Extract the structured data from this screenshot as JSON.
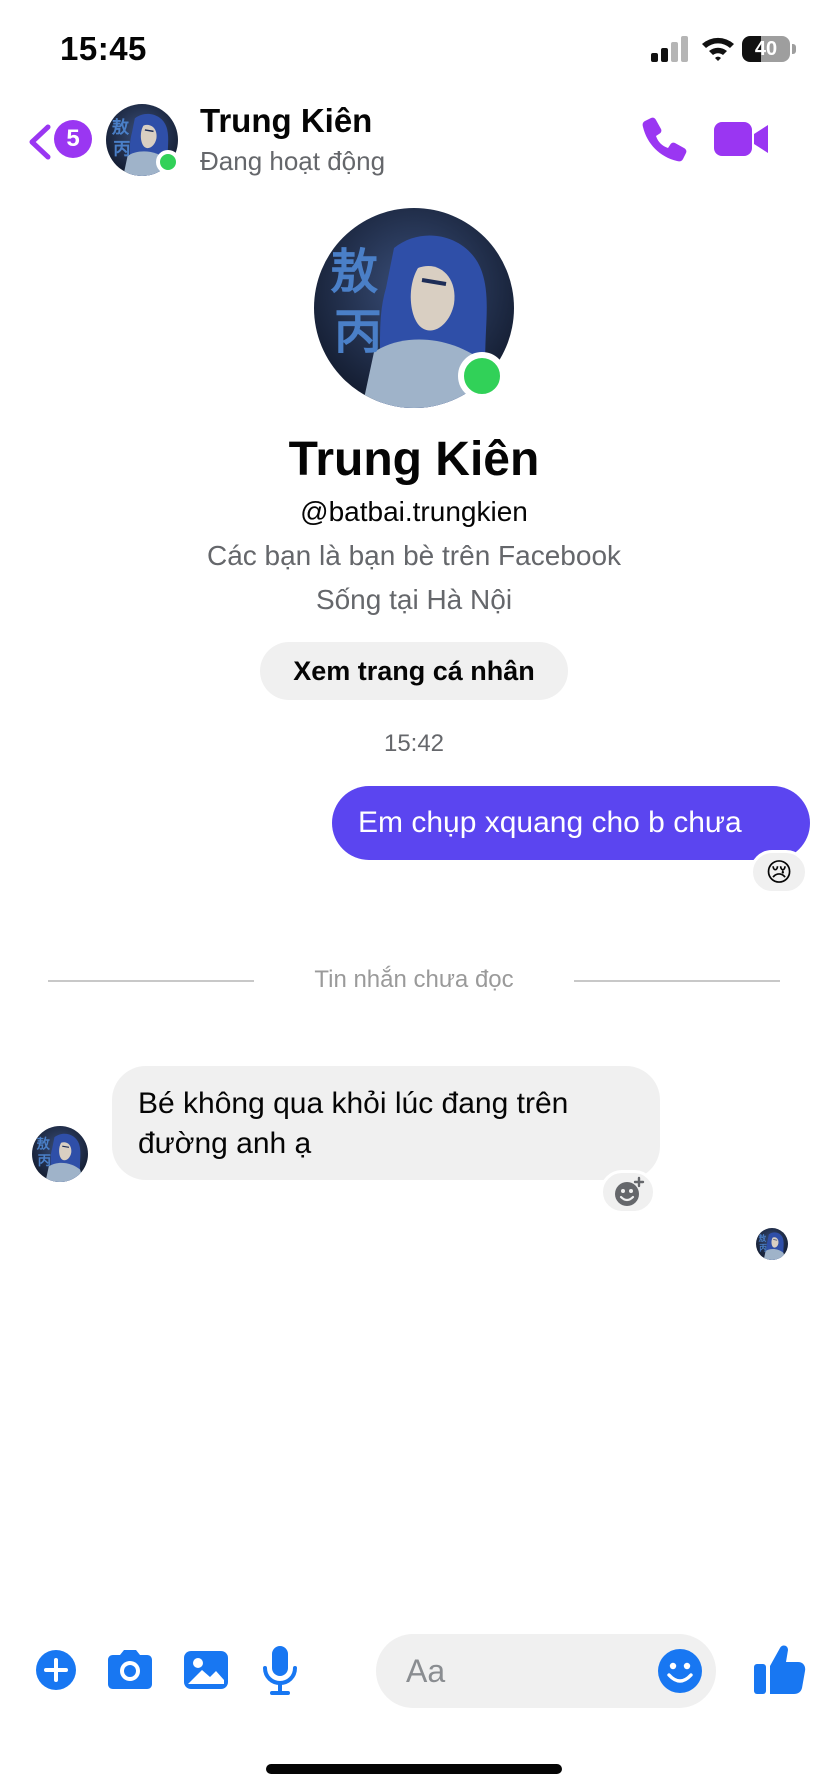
{
  "status_bar": {
    "time": "15:45",
    "battery": "40",
    "battery_level": 0.4
  },
  "header": {
    "back_badge": "5",
    "name": "Trung Kiên",
    "status": "Đang hoạt động"
  },
  "profile": {
    "name": "Trung Kiên",
    "username": "@batbai.trungkien",
    "friends_line": "Các bạn là bạn bè trên Facebook",
    "location_line": "Sống tại Hà Nội",
    "view_profile_label": "Xem trang cá nhân"
  },
  "conversation": {
    "timestamp": "15:42",
    "outgoing_message": "Em chụp xquang cho b chưa",
    "outgoing_reaction": "😢",
    "unread_divider": "Tin nhắn chưa đọc",
    "incoming_message": "Bé không qua khỏi lúc đang trên đường anh ạ"
  },
  "composer": {
    "placeholder": "Aa"
  },
  "colors": {
    "accent": "#9a36f2",
    "outgoing_bubble": "#5b45f0",
    "incoming_bubble": "#f0f0f0",
    "online": "#31d158",
    "composer_icons": "#1877f2"
  }
}
